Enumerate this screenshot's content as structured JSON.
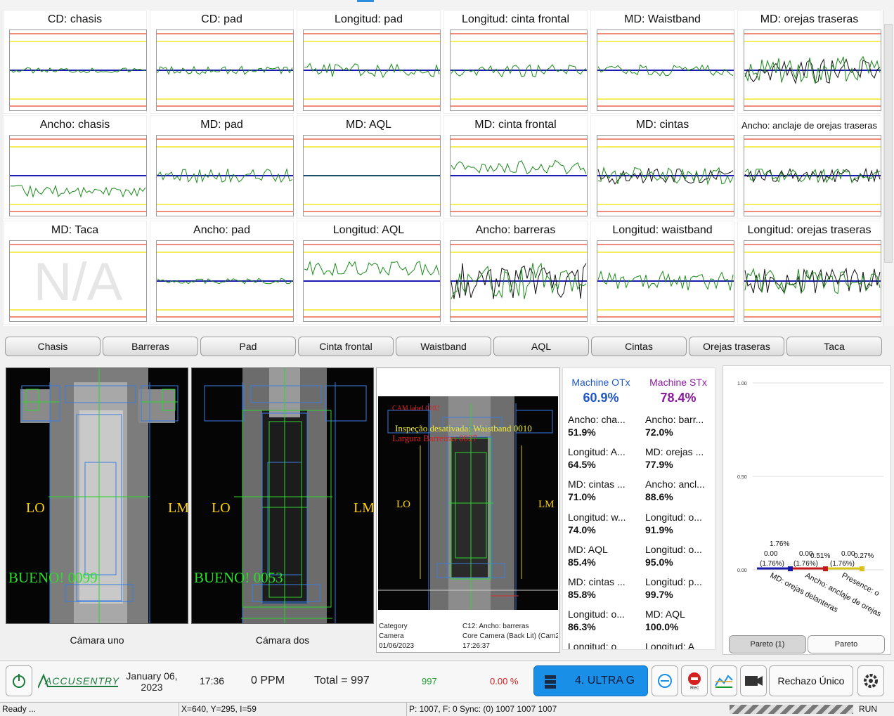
{
  "charts": [
    {
      "title": "CD: chasis"
    },
    {
      "title": "CD: pad"
    },
    {
      "title": "Longitud: pad"
    },
    {
      "title": "Longitud: cinta frontal"
    },
    {
      "title": "MD: Waistband"
    },
    {
      "title": "MD: orejas traseras"
    },
    {
      "title": "Ancho: chasis"
    },
    {
      "title": "MD: pad"
    },
    {
      "title": "MD: AQL"
    },
    {
      "title": "MD: cinta frontal"
    },
    {
      "title": "MD: cintas"
    },
    {
      "title": "Ancho: anclaje de orejas traseras"
    },
    {
      "title": "MD: Taca",
      "na": "N/A"
    },
    {
      "title": "Ancho: pad"
    },
    {
      "title": "Longitud: AQL"
    },
    {
      "title": "Ancho: barreras"
    },
    {
      "title": "Longitud: waistband"
    },
    {
      "title": "Longitud: orejas traseras"
    }
  ],
  "tabs": [
    "Chasis",
    "Barreras",
    "Pad",
    "Cinta frontal",
    "Waistband",
    "AQL",
    "Cintas",
    "Orejas traseras",
    "Taca"
  ],
  "camera_one": {
    "caption": "Cámara uno",
    "left_label": "LO",
    "right_label": "LM",
    "status": "BUENO! 0099"
  },
  "camera_two": {
    "caption": "Cámara dos",
    "left_label": "LO",
    "right_label": "LM",
    "status": "BUENO! 0053"
  },
  "camera_three": {
    "overlay_1": "CAM label 0102",
    "overlay_2": "Inspeção desativada: Waistband 0010",
    "overlay_3": "Largura Barreiras 0027",
    "left_label": "LO",
    "right_label": "LM",
    "meta": {
      "category_label": "Category",
      "category_value": "C12: Ancho: barreras",
      "camera_label": "Camera",
      "camera_value": "Core Camera (Back Lit) (Cam2",
      "date": "01/06/2023",
      "time": "17:26:37"
    }
  },
  "stats": {
    "otx_label": "Machine OTx",
    "otx_value": "60.9%",
    "stx_label": "Machine STx",
    "stx_value": "78.4%",
    "left": [
      {
        "name": "Ancho: cha...",
        "pct": "51.9%"
      },
      {
        "name": "Longitud: A...",
        "pct": "64.5%"
      },
      {
        "name": "MD: cintas ...",
        "pct": "71.0%"
      },
      {
        "name": "Longitud: w...",
        "pct": "74.0%"
      },
      {
        "name": "MD: AQL",
        "pct": "85.4%"
      },
      {
        "name": "MD: cintas ...",
        "pct": "85.8%"
      },
      {
        "name": "Longitud: o...",
        "pct": "86.3%"
      },
      {
        "name": "Longitud: o",
        "pct": ""
      }
    ],
    "right": [
      {
        "name": "Ancho: barr...",
        "pct": "72.0%"
      },
      {
        "name": "MD: orejas ...",
        "pct": "77.9%"
      },
      {
        "name": "Ancho: ancl...",
        "pct": "88.6%"
      },
      {
        "name": "Longitud: o...",
        "pct": "91.9%"
      },
      {
        "name": "Longitud: o...",
        "pct": "95.0%"
      },
      {
        "name": "Longitud: p...",
        "pct": "99.7%"
      },
      {
        "name": "MD: AQL",
        "pct": "100.0%"
      },
      {
        "name": "Longitud: A",
        "pct": ""
      }
    ]
  },
  "pareto": {
    "y_ticks": [
      "1.00",
      "0.50",
      "0.00"
    ],
    "labels": [
      "1.76%",
      "0.00",
      "(1.76%)",
      "0.00",
      "(1.76%)",
      "0.51%",
      "0.00",
      "(1.76%)",
      "0.27%"
    ],
    "x_labels": [
      "MD: orejas delanteras",
      "Ancho: anclaje de orejas",
      "Presence: o"
    ],
    "btn_active": "Pareto (1)",
    "btn_other": "Pareto",
    "colors": [
      "#1a1aa8",
      "#c21a1a",
      "#d9c21a"
    ]
  },
  "bottom": {
    "brand": "ACCUSENTRY",
    "date_line1": "January 06,",
    "date_line2": "2023",
    "time": "17:36",
    "ppm": "0 PPM",
    "total": "Total = 997",
    "count": "997",
    "rate": "0.00 %",
    "recipe": "4. ULTRA G",
    "reject": "Rechazo Único",
    "rec_label": "Rec"
  },
  "status": {
    "ready": "Ready ...",
    "coords": "X=640, Y=295, I=59",
    "sync": "P: 1007, F: 0 Sync: (0) 1007 1007 1007",
    "run": "RUN"
  }
}
